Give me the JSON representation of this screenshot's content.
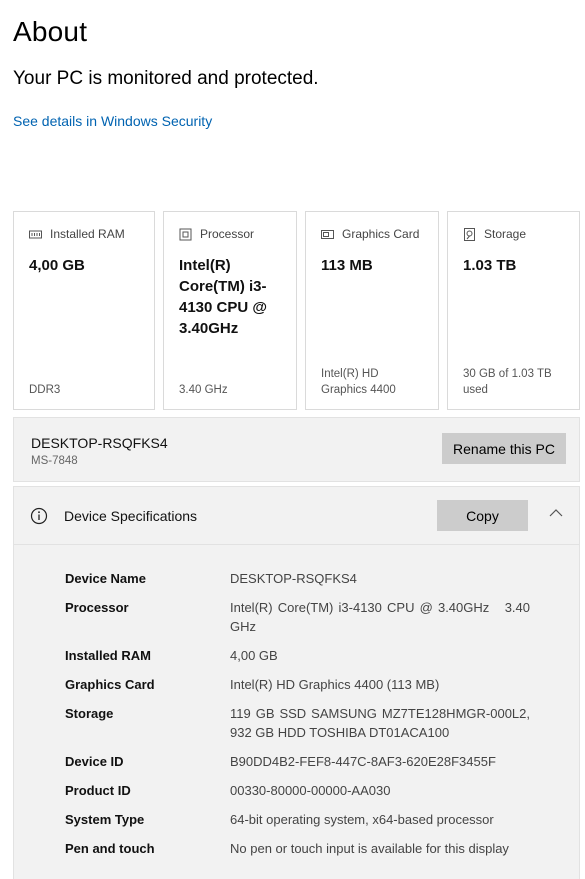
{
  "header": {
    "title": "About",
    "status": "Your PC is monitored and protected.",
    "security_link": "See details in Windows Security"
  },
  "cards": [
    {
      "label": "Installed RAM",
      "value": "4,00 GB",
      "sub": "DDR3",
      "icon": "ram-icon"
    },
    {
      "label": "Processor",
      "value": "Intel(R) Core(TM) i3-4130 CPU @ 3.40GHz",
      "sub": "3.40 GHz",
      "icon": "processor-icon"
    },
    {
      "label": "Graphics Card",
      "value": "113 MB",
      "sub": "Intel(R) HD Graphics 4400",
      "icon": "graphics-card-icon"
    },
    {
      "label": "Storage",
      "value": "1.03 TB",
      "sub": "30 GB of 1.03 TB used",
      "icon": "storage-icon"
    }
  ],
  "pc": {
    "name": "DESKTOP-RSQFKS4",
    "model": "MS-7848",
    "rename_label": "Rename this PC"
  },
  "device_specs": {
    "title": "Device Specifications",
    "copy_label": "Copy",
    "rows": [
      {
        "key": "Device Name",
        "value": "DESKTOP-RSQFKS4"
      },
      {
        "key": "Processor",
        "value": "Intel(R) Core(TM) i3-4130 CPU @ 3.40GHz   3.40 GHz"
      },
      {
        "key": "Installed RAM",
        "value": "4,00 GB"
      },
      {
        "key": "Graphics Card",
        "value": "Intel(R) HD Graphics 4400 (113 MB)"
      },
      {
        "key": "Storage",
        "value": "119 GB SSD SAMSUNG MZ7TE128HMGR-000L2, 932 GB HDD TOSHIBA DT01ACA100"
      },
      {
        "key": "Device ID",
        "value": "B90DD4B2-FEF8-447C-8AF3-620E28F3455F"
      },
      {
        "key": "Product ID",
        "value": "00330-80000-00000-AA030"
      },
      {
        "key": "System Type",
        "value": "64-bit operating system, x64-based processor"
      },
      {
        "key": "Pen and touch",
        "value": "No pen or touch input is available for this display"
      }
    ]
  },
  "colors": {
    "link": "#0063b1",
    "button": "#cccccc",
    "panel": "#f2f2f2"
  }
}
